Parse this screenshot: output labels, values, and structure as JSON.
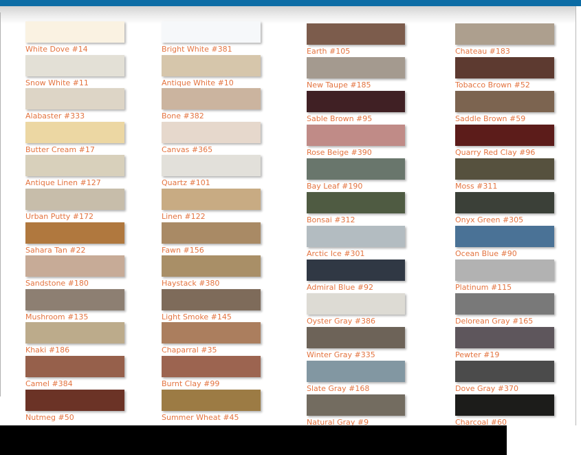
{
  "page": {
    "top_bar_color": "#0c6ca5",
    "bottom_bar_color": "#000000",
    "sheet_color": "#ffffff",
    "label_color": "#e3733f"
  },
  "columns": [
    {
      "id": "column-1",
      "swatches": [
        {
          "name": "White Dove #14",
          "color": "#faf2e2"
        },
        {
          "name": "Snow White #11",
          "color": "#e3e0d6"
        },
        {
          "name": "Alabaster #333",
          "color": "#ddd5c6"
        },
        {
          "name": "Butter Cream #17",
          "color": "#ecd7a3"
        },
        {
          "name": "Antique Linen #127",
          "color": "#d8d0bb"
        },
        {
          "name": "Urban Putty #172",
          "color": "#c7bdaa"
        },
        {
          "name": "Sahara Tan #22",
          "color": "#b0783e"
        },
        {
          "name": "Sandstone #180",
          "color": "#c7ab97"
        },
        {
          "name": "Mushroom #135",
          "color": "#8d7f72"
        },
        {
          "name": "Khaki #186",
          "color": "#bcab8b"
        },
        {
          "name": "Camel #384",
          "color": "#96604b"
        },
        {
          "name": "Nutmeg #50",
          "color": "#6b3326"
        }
      ]
    },
    {
      "id": "column-2",
      "swatches": [
        {
          "name": "Bright White #381",
          "color": "#f6f8fa"
        },
        {
          "name": "Antique White #10",
          "color": "#d6c6ab"
        },
        {
          "name": "Bone #382",
          "color": "#cbb49f"
        },
        {
          "name": "Canvas #365",
          "color": "#e6d8cc"
        },
        {
          "name": "Quartz #101",
          "color": "#e2e0da"
        },
        {
          "name": "Linen #122",
          "color": "#c8ab83"
        },
        {
          "name": "Fawn #156",
          "color": "#a98a65"
        },
        {
          "name": "Haystack #380",
          "color": "#a98f67"
        },
        {
          "name": "Light Smoke #145",
          "color": "#7e6b5a"
        },
        {
          "name": "Chaparral #35",
          "color": "#ab7e5e"
        },
        {
          "name": "Burnt Clay #99",
          "color": "#9c6450"
        },
        {
          "name": "Summer Wheat #45",
          "color": "#9c7b44"
        }
      ]
    },
    {
      "id": "column-3",
      "swatches": [
        {
          "name": "Earth #105",
          "color": "#7c5c4c"
        },
        {
          "name": "New Taupe #185",
          "color": "#a49a8f"
        },
        {
          "name": "Sable Brown #95",
          "color": "#402024"
        },
        {
          "name": "Rose Beige #390",
          "color": "#c08b87"
        },
        {
          "name": "Bay Leaf #190",
          "color": "#69766c"
        },
        {
          "name": "Bonsai #312",
          "color": "#4f5b42"
        },
        {
          "name": "Arctic Ice #301",
          "color": "#b3bcc1"
        },
        {
          "name": "Admiral Blue #92",
          "color": "#303844"
        },
        {
          "name": "Oyster Gray #386",
          "color": "#dddbd4"
        },
        {
          "name": "Winter Gray #335",
          "color": "#6d6358"
        },
        {
          "name": "Slate Gray #168",
          "color": "#8297a2"
        },
        {
          "name": "Natural Gray #9",
          "color": "#736c60"
        }
      ]
    },
    {
      "id": "column-4",
      "swatches": [
        {
          "name": "Chateau #183",
          "color": "#ad9f8e"
        },
        {
          "name": "Tobacco Brown #52",
          "color": "#5d3a30"
        },
        {
          "name": "Saddle Brown #59",
          "color": "#7c6450"
        },
        {
          "name": "Quarry Red Clay #96",
          "color": "#5c1c1a"
        },
        {
          "name": "Moss #311",
          "color": "#56513e"
        },
        {
          "name": "Onyx Green #305",
          "color": "#3b4038"
        },
        {
          "name": "Ocean Blue #90",
          "color": "#4a7296"
        },
        {
          "name": "Platinum #115",
          "color": "#b2b2b2"
        },
        {
          "name": "Delorean Gray #165",
          "color": "#797979"
        },
        {
          "name": "Pewter #19",
          "color": "#5e565c"
        },
        {
          "name": "Dove Gray #370",
          "color": "#4b4b4b"
        },
        {
          "name": "Charcoal #60",
          "color": "#1c1c1a"
        }
      ]
    }
  ]
}
